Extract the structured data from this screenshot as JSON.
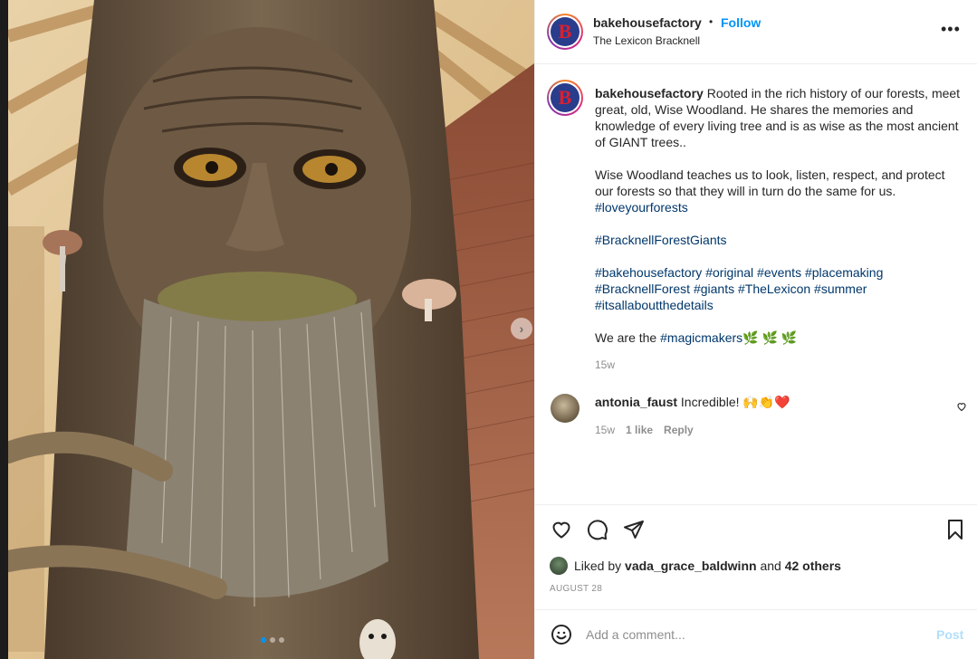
{
  "header": {
    "username": "bakehousefactory",
    "separator": "•",
    "follow_label": "Follow",
    "location": "The Lexicon Bracknell",
    "avatar_letter": "B",
    "more_label": "•••"
  },
  "caption": {
    "username": "bakehousefactory",
    "text1": "Rooted in the rich history of our forests, meet great, old, Wise Woodland. He shares the memories and knowledge of every living tree and is as wise as the most ancient of GIANT trees..",
    "text2": "Wise Woodland teaches us to look, listen, respect, and protect our forests so that they will in turn do the same for us.",
    "tag_loveyourforests": "#loveyourforests",
    "tag_bracknellforestgiants": "#BracknellForestGiants",
    "tags3": [
      "#bakehousefactory",
      "#original",
      "#events",
      "#placemaking",
      "#BracknellForest",
      "#giants",
      "#TheLexicon",
      "#summer",
      "#itsallaboutthedetails"
    ],
    "magic_prefix": "We are the",
    "tag_magicmakers": "#magicmakers",
    "magic_emoji": "🌿 🌿 🌿",
    "time": "15w"
  },
  "comment": {
    "username": "antonia_faust",
    "text": "Incredible! 🙌👏❤️",
    "time": "15w",
    "likes": "1 like",
    "reply_label": "Reply"
  },
  "actions": {
    "liked_prefix": "Liked by",
    "liked_user": "vada_grace_baldwinn",
    "liked_and": "and",
    "liked_others": "42 others",
    "date": "AUGUST 28"
  },
  "comment_box": {
    "placeholder": "Add a comment...",
    "post_label": "Post"
  },
  "carousel": {
    "dots": 3,
    "active": 0,
    "next_label": "›"
  },
  "colors": {
    "accent": "#0095f6",
    "hashtag": "#00376b",
    "muted": "#8e8e8e",
    "text": "#262626",
    "like_red": "#ed4956"
  }
}
